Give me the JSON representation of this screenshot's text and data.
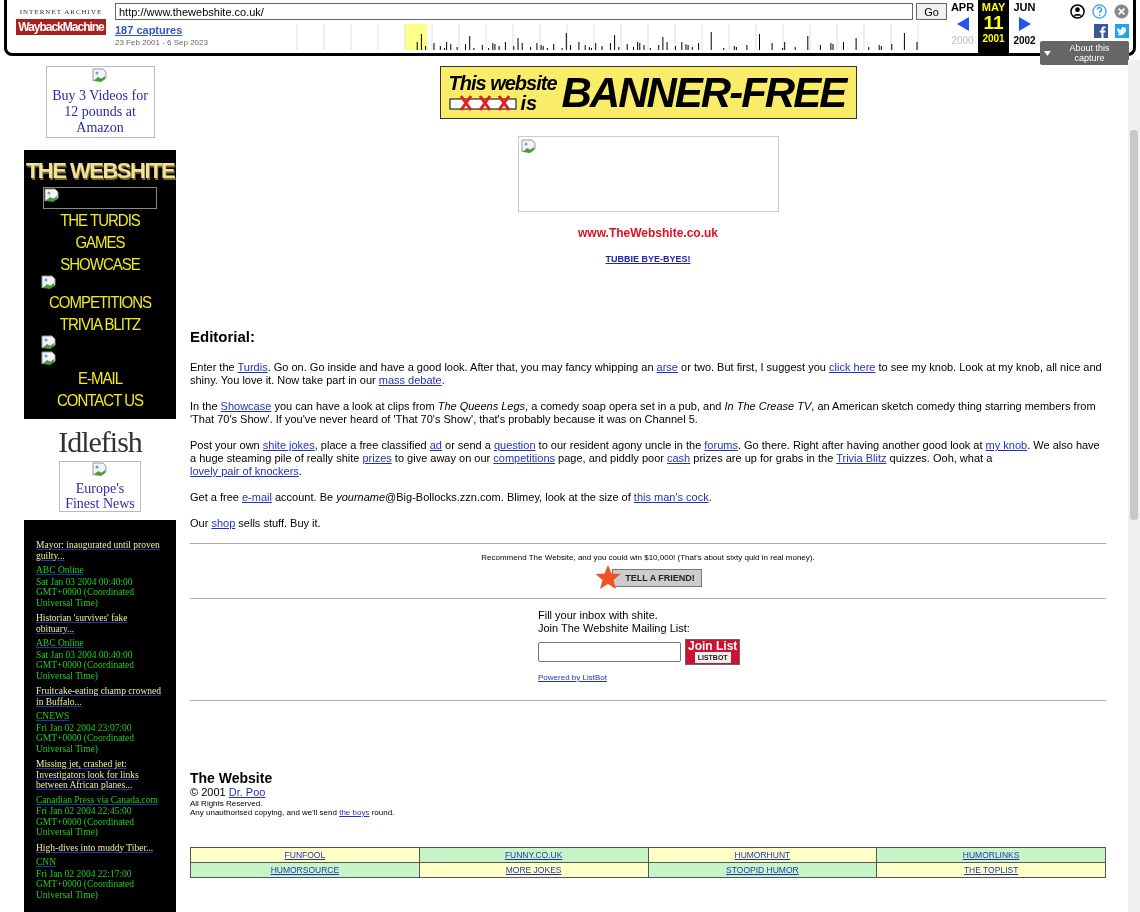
{
  "toolbar": {
    "logo_top": "INTERNET ARCHIVE",
    "logo": "WaybackMachine",
    "url": "http://www.thewebshite.co.uk/",
    "go": "Go",
    "captures": "187 captures",
    "range": "23 Feb 2001 - 6 Sep 2023",
    "months": [
      {
        "label": "APR",
        "selected": false
      },
      {
        "label": "MAY",
        "selected": true
      },
      {
        "label": "JUN",
        "selected": false
      }
    ],
    "day": "11",
    "years": [
      {
        "label": "2000",
        "selected": false,
        "disabled": true
      },
      {
        "label": "2001",
        "selected": true,
        "disabled": false
      },
      {
        "label": "2002",
        "selected": false,
        "disabled": false
      }
    ],
    "about": "About this capture"
  },
  "sidebar": {
    "ad": "Buy 3 Videos for 12 pounds at Amazon",
    "brand": "THE WEBSHITE",
    "menu": [
      {
        "kind": "frame"
      },
      {
        "kind": "text",
        "label": "THE TURDIS"
      },
      {
        "kind": "text",
        "label": "GAMES"
      },
      {
        "kind": "text",
        "label": "SHOWCASE"
      },
      {
        "kind": "broken"
      },
      {
        "kind": "text",
        "label": "COMPETITIONS"
      },
      {
        "kind": "text",
        "label": "TRIVIA BLITZ"
      },
      {
        "kind": "broken"
      },
      {
        "kind": "broken"
      },
      {
        "kind": "text",
        "label": "E-MAIL"
      },
      {
        "kind": "text",
        "label": "CONTACT US"
      }
    ],
    "partner": "Idlefish",
    "news_ad": "Europe's Finest News",
    "news": [
      {
        "headline": "Mayor: inaugurated until proven guilty...",
        "source": "ABC Online",
        "date": "Sat Jan 03 2004 00:40:00 GMT+0000 (Coordinated Universal Time)"
      },
      {
        "headline": "Historian 'survives' fake obituary...",
        "source": "ABC Online",
        "date": "Sat Jan 03 2004 00:40:00 GMT+0000 (Coordinated Universal Time)"
      },
      {
        "headline": "Fruitcake-eating champ crowned in Buffalo...",
        "source": "CNEWS",
        "date": "Fri Jan 02 2004 23:07:00 GMT+0000 (Coordinated Universal Time)"
      },
      {
        "headline": "Missing jet, crashed jet: Investigators look for links between African planes...",
        "source": "Canadian Press via Canada.com",
        "date": "Fri Jan 02 2004 22:45:00 GMT+0000 (Coordinated Universal Time)"
      },
      {
        "headline": "High-dives into muddy Tiber...",
        "source": "CNN",
        "date": "Fri Jan 02 2004 22:17:00 GMT+0000 (Coordinated Universal Time)"
      }
    ]
  },
  "main": {
    "banner": {
      "line1": "This website",
      "is": "is",
      "big": "BANNER-FREE"
    },
    "site_url": "www.TheWebshite.co.uk",
    "tubbie": "TUBBIE BYE-BYES!",
    "heading": "Editorial:",
    "paragraphs": [
      [
        {
          "kind": "text",
          "text": "Enter the "
        },
        {
          "kind": "link",
          "text": "Turdis"
        },
        {
          "kind": "text",
          "text": ". Go on. Go inside and have a good look. After that, you may fancy whipping an "
        },
        {
          "kind": "link",
          "text": "arse"
        },
        {
          "kind": "text",
          "text": " or two. But first, I suggest you "
        },
        {
          "kind": "link",
          "text": "click here"
        },
        {
          "kind": "text",
          "text": " to see my knob. Look at my knob, all nice and shiny. You love it. Now take part in our "
        },
        {
          "kind": "link",
          "text": "mass debate"
        },
        {
          "kind": "text",
          "text": "."
        }
      ],
      [
        {
          "kind": "text",
          "text": "In the "
        },
        {
          "kind": "link",
          "text": "Showcase"
        },
        {
          "kind": "text",
          "text": " you can have a look at clips from *The Queens Legs*, a comedy soap opera set in a pub, and *In The Crease TV*, an American sketch comedy thing starring members from 'That 70's Show'. If you've never heard of 'That 70's Show', that's probably because it was on Channel 5."
        }
      ],
      [
        {
          "kind": "text",
          "text": "Post your own "
        },
        {
          "kind": "link",
          "text": "shite jokes"
        },
        {
          "kind": "text",
          "text": ", place a free classified "
        },
        {
          "kind": "link",
          "text": "ad"
        },
        {
          "kind": "text",
          "text": " or send a "
        },
        {
          "kind": "link",
          "text": "question"
        },
        {
          "kind": "text",
          "text": " to our resident agony uncle in the "
        },
        {
          "kind": "link",
          "text": "forums"
        },
        {
          "kind": "text",
          "text": ". Go there. Right after having another good look at "
        },
        {
          "kind": "link",
          "text": "my knob"
        },
        {
          "kind": "text",
          "text": ". We also have a huge steaming pile of really shite "
        },
        {
          "kind": "link",
          "text": "prizes"
        },
        {
          "kind": "text",
          "text": " to give away on our "
        },
        {
          "kind": "link",
          "text": "competitions"
        },
        {
          "kind": "text",
          "text": " page, and piddly poor "
        },
        {
          "kind": "link",
          "text": "cash"
        },
        {
          "kind": "text",
          "text": " prizes are up for grabs in the "
        },
        {
          "kind": "link",
          "text": "Trivia Blitz"
        },
        {
          "kind": "text",
          "text": " quizzes. Ooh, what a "
        },
        {
          "kind": "link",
          "text": "lovely pair of knockers"
        },
        {
          "kind": "text",
          "text": "."
        }
      ],
      [
        {
          "kind": "text",
          "text": "Get a free "
        },
        {
          "kind": "link",
          "text": "e-mail"
        },
        {
          "kind": "text",
          "text": " account. Be *yourname*@Big-Bollocks.zzn.com. Blimey, look at the size of "
        },
        {
          "kind": "link",
          "text": "this man's cock"
        },
        {
          "kind": "text",
          "text": "."
        }
      ],
      [
        {
          "kind": "text",
          "text": "Our "
        },
        {
          "kind": "link",
          "text": "shop"
        },
        {
          "kind": "text",
          "text": " sells stuff. Buy it."
        }
      ]
    ],
    "recommend": "Recommend The Website, and you could win $10,000! (That's about sixty quid in real money).",
    "tell_friend": "TELL A FRIEND!",
    "mailing": {
      "line1": "Fill your inbox with shite.",
      "line2": "Join The Webshite Mailing List:",
      "join": "Join List",
      "join_brand": "LISTBOT",
      "powered": "Powered by ListBot"
    },
    "footer": {
      "title": "The Website",
      "copyright": [
        {
          "kind": "text",
          "text": "© 2001 "
        },
        {
          "kind": "link",
          "text": "Dr. Poo"
        }
      ],
      "rights": "All Rights Reserved.",
      "notice": [
        {
          "kind": "text",
          "text": "Any unauthorised copying, and we'll send "
        },
        {
          "kind": "link",
          "text": "the boys"
        },
        {
          "kind": "text",
          "text": " round."
        }
      ]
    },
    "links": [
      [
        "FUNFOOL",
        "FUNNY.CO.UK",
        "HUMORHUNT",
        "HUMORLINKS"
      ],
      [
        "HUMORSOURCE",
        "MORE JOKES",
        "STOOPID HUMOR",
        "THE TOPLIST"
      ]
    ]
  }
}
